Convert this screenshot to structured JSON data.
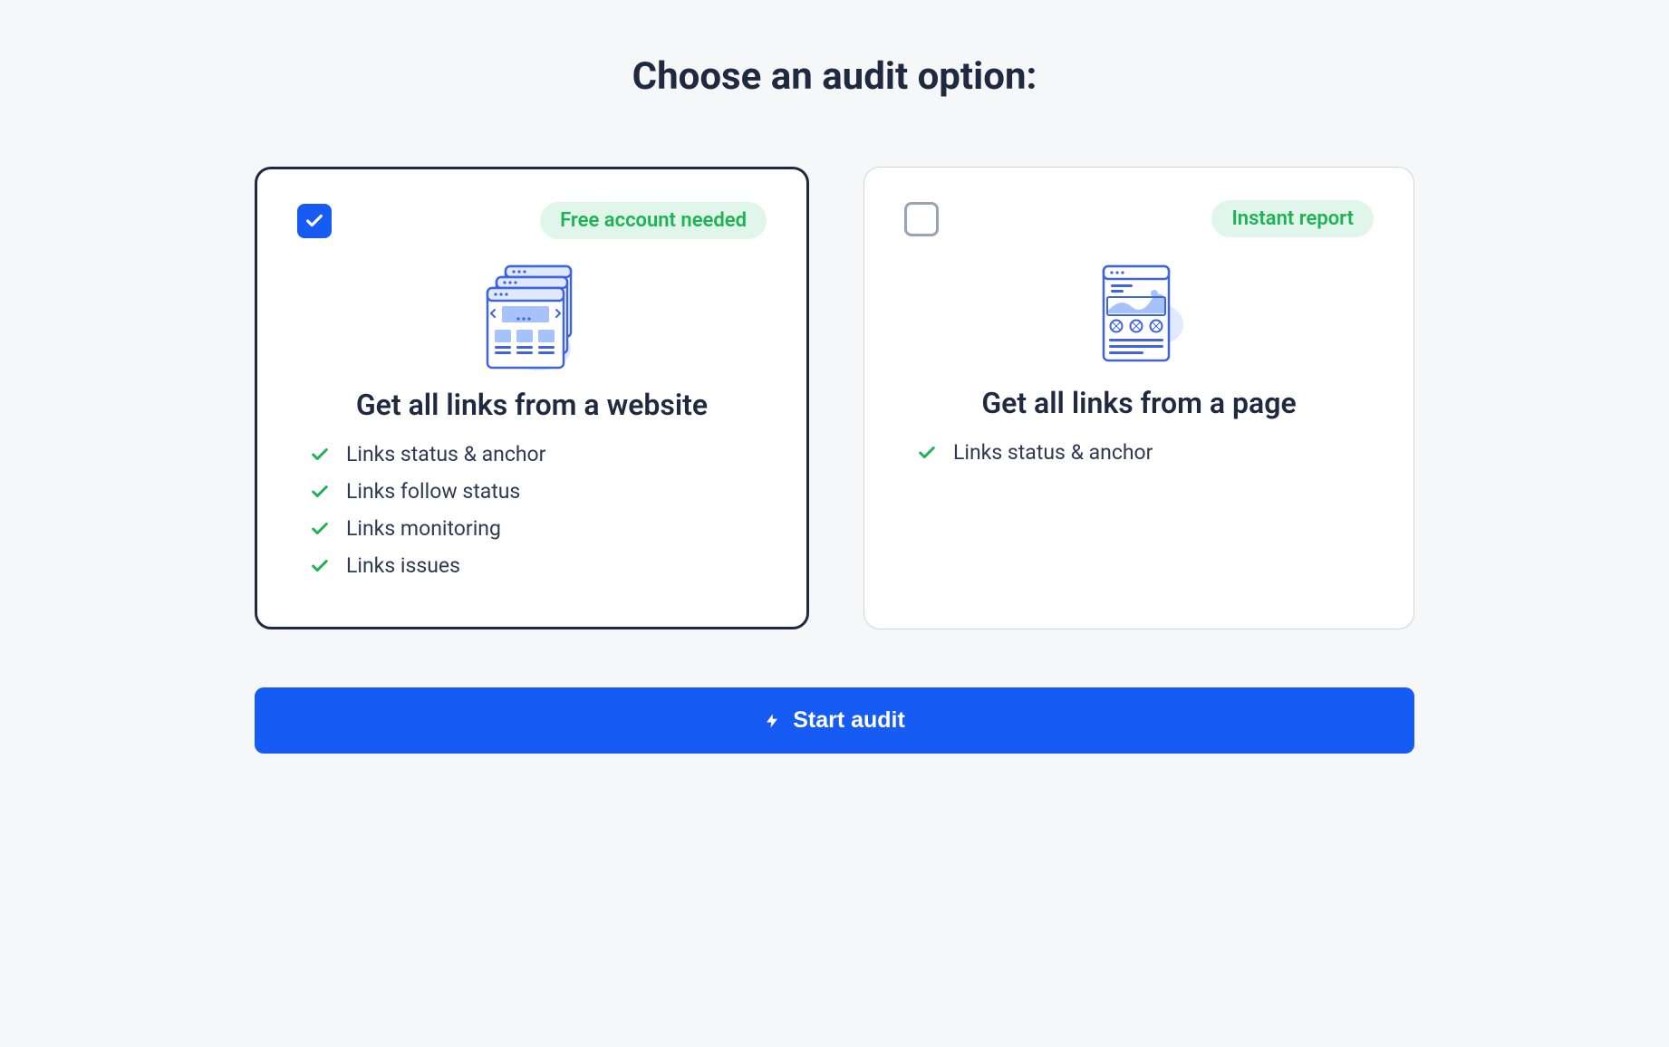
{
  "title": "Choose an audit option:",
  "options": [
    {
      "selected": true,
      "badge": "Free account needed",
      "heading": "Get all links from a website",
      "features": [
        "Links status & anchor",
        "Links follow status",
        "Links monitoring",
        "Links issues"
      ]
    },
    {
      "selected": false,
      "badge": "Instant report",
      "heading": "Get all links from a page",
      "features": [
        "Links status & anchor"
      ]
    }
  ],
  "cta": "Start audit"
}
